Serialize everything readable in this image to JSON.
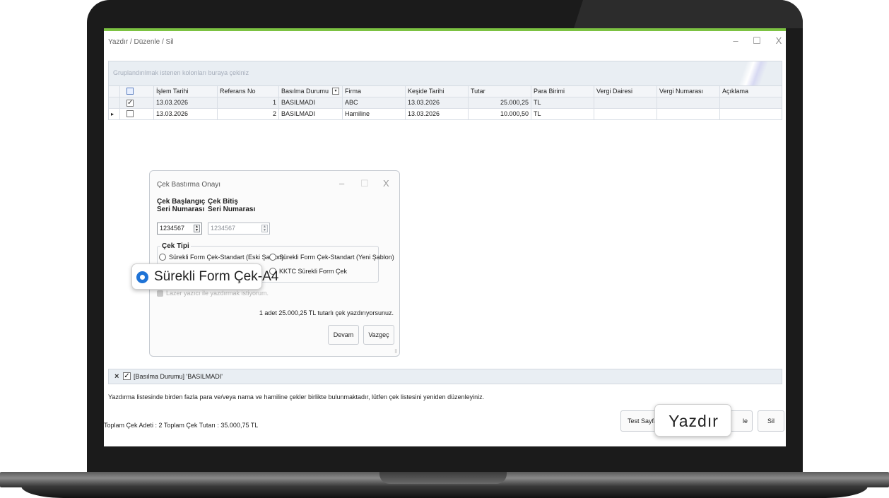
{
  "window": {
    "title": "Yazdır / Düzenle  / Sil",
    "minimize": "–",
    "maximize": "☐",
    "close": "X"
  },
  "group_panel": {
    "hint": "Gruplandırılmak istenen kolonları buraya çekiniz"
  },
  "grid": {
    "columns": {
      "islem_tarihi": "İşlem Tarihi",
      "referans_no": "Referans No",
      "basilma_durumu": "Basılma Durumu",
      "firma": "Firma",
      "keside_tarihi": "Keşide Tarihi",
      "tutar": "Tutar",
      "para_birimi": "Para Birimi",
      "vergi_dairesi": "Vergi Dairesi",
      "vergi_numarasi": "Vergi Numarası",
      "aciklama": "Açıklama"
    },
    "rows": [
      {
        "checked": "✓",
        "islem_tarihi": "13.03.2026",
        "referans_no": "1",
        "basilma_durumu": "BASILMADI",
        "firma": "ABC",
        "keside_tarihi": "13.03.2026",
        "tutar": "25.000,25",
        "para_birimi": "TL"
      },
      {
        "checked": "",
        "indicator": "▸",
        "islem_tarihi": "13.03.2026",
        "referans_no": "2",
        "basilma_durumu": "BASILMADI",
        "firma": "Hamiline",
        "keside_tarihi": "13.03.2026",
        "tutar": "10.000,50",
        "para_birimi": "TL"
      }
    ]
  },
  "filter_bar": {
    "clear": "×",
    "checked": "✓",
    "text": "[Basılma Durumu]  'BASILMADI'"
  },
  "warning_text": "Yazdırma listesinde birden fazla para ve/veya nama ve hamiline çekler birlikte bulunmaktadır, lütfen çek listesini yeniden düzenleyiniz.",
  "totals_text": "Toplam Çek Adeti : 2 Toplam Çek Tutarı : 35.000,75 TL",
  "buttons": {
    "test_sayfa": "Test Sayfa",
    "duzenle_tail": "le",
    "sil": "Sil"
  },
  "callouts": {
    "yazdir": "Yazdır",
    "surekli_form_a4": "Sürekli Form Çek-A4"
  },
  "dialog": {
    "title": "Çek Bastırma Onayı",
    "minimize": "–",
    "maximize": "☐",
    "close": "X",
    "start_label_1": "Çek Başlangıç",
    "start_label_2": "Seri Numarası",
    "end_label_1": "Çek Bitiş",
    "end_label_2": "Seri Numarası",
    "start_value": "1234567",
    "end_value": "1234567",
    "cek_tipi_label": "Çek Tipi",
    "radio_eski": "Sürekli Form Çek-Standart (Eski Şablon)",
    "radio_yeni": "Sürekli Form Çek-Standart (Yeni Şablon)",
    "radio_kktc": "KKTC Sürekli Form Çek",
    "laser_label": "Lazer yazıcı ile yazdırmak istiyorum.",
    "summary": "1 adet 25.000,25 TL tutarlı çek yazdırıyorsunuz.",
    "devam": "Devam",
    "vazgec": "Vazgeç"
  }
}
